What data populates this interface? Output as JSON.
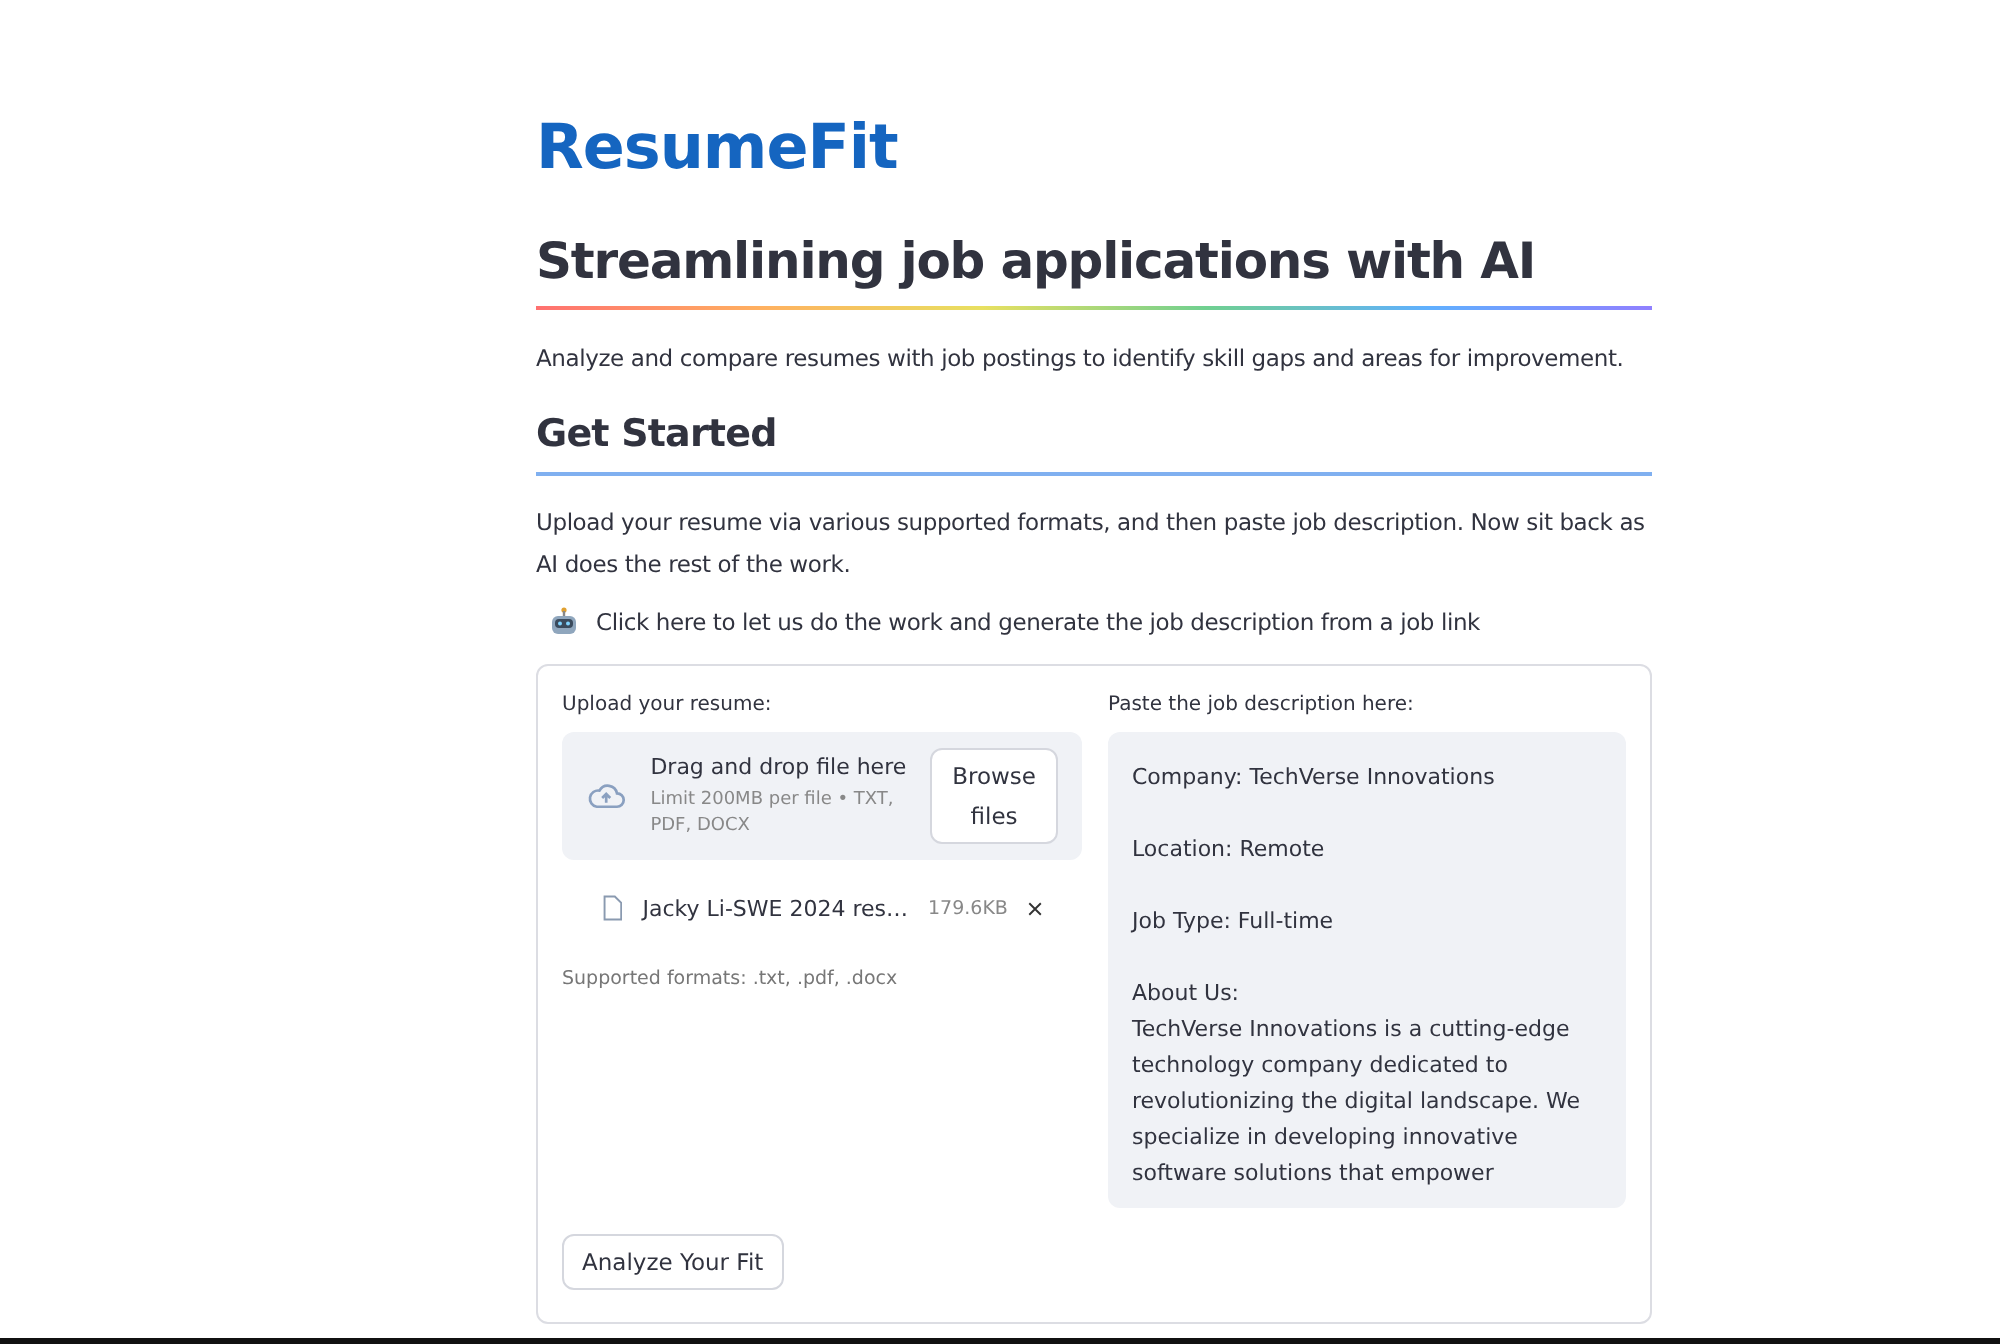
{
  "app_title": "ResumeFit",
  "heading": "Streamlining job applications with AI",
  "intro": "Analyze and compare resumes with job postings to identify skill gaps and areas for improvement.",
  "section_title": "Get Started",
  "instructions": "Upload your resume via various supported formats, and then paste job description. Now sit back as AI does the rest of the work.",
  "expander": {
    "label": "Click here to let us do the work and generate the job description from a job link",
    "expanded": false
  },
  "uploader": {
    "label": "Upload your resume:",
    "drop_title": "Drag and drop file here",
    "limit": "Limit 200MB per file • TXT, PDF, DOCX",
    "browse_button": "Browse files",
    "files": [
      {
        "name": "Jacky Li-SWE 2024 res…",
        "size": "179.6KB"
      }
    ],
    "caption": "Supported formats: .txt, .pdf, .docx"
  },
  "job_description": {
    "label": "Paste the job description here:",
    "value": "Company: TechVerse Innovations\n\nLocation: Remote\n\nJob Type: Full-time\n\nAbout Us:\nTechVerse Innovations is a cutting-edge technology company dedicated to revolutionizing the digital landscape. We specialize in developing innovative software solutions that empower"
  },
  "analyze_button": "Analyze Your Fit"
}
